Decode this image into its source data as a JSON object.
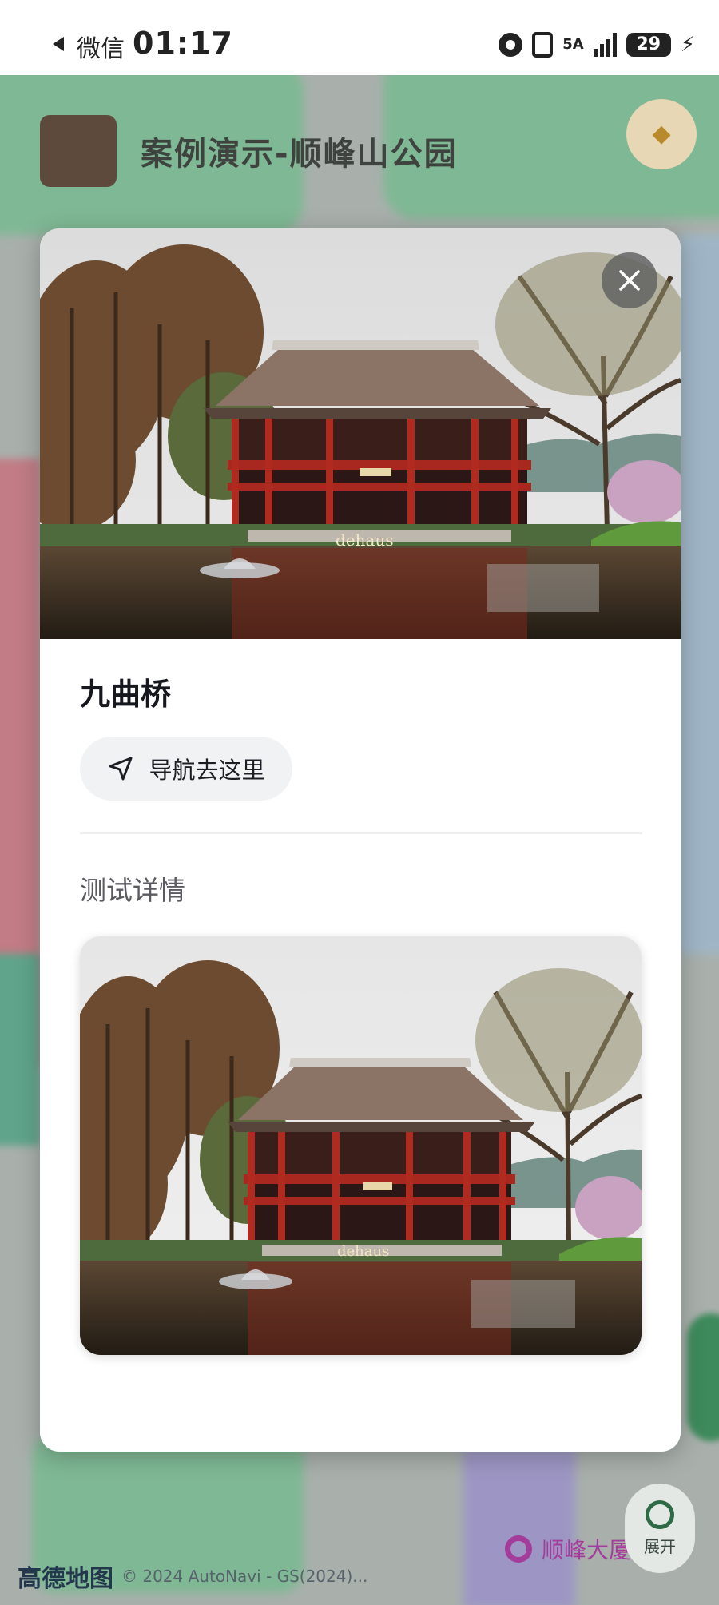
{
  "status_bar": {
    "back_app": "微信",
    "time": "01:17",
    "network_label": "5A",
    "battery_level": "29"
  },
  "map": {
    "header_title": "案例演示-顺峰山公园",
    "footer_logo": "高德地图",
    "footer_copyright": "© 2024 AutoNavi - GS(2024)...",
    "poi_label": "顺峰大厦",
    "side_button_label": "展开"
  },
  "modal": {
    "place_name": "九曲桥",
    "nav_button_label": "导航去这里",
    "section_title": "测试详情",
    "photo_watermark": "dehaus"
  },
  "colors": {
    "map_green": "#7fb894",
    "accent_red": "#a8271f",
    "button_bg": "#f1f2f4"
  },
  "icons": [
    "back-arrow-icon",
    "alarm-icon",
    "vibrate-icon",
    "signal-icon",
    "battery-icon",
    "charging-bolt-icon",
    "close-icon",
    "navigation-arrow-icon"
  ]
}
